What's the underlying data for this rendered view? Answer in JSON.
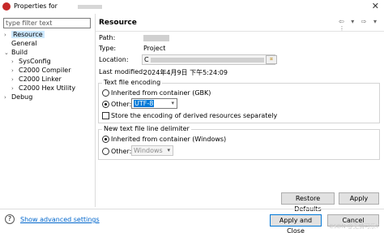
{
  "window": {
    "title": "Properties for",
    "close_symbol": "✕"
  },
  "filter": {
    "placeholder": "type filter text"
  },
  "tree": {
    "items": [
      {
        "label": "Resource",
        "arrow": "›",
        "selected": true
      },
      {
        "label": "General",
        "arrow": ""
      },
      {
        "label": "Build",
        "arrow": "⌄"
      },
      {
        "label": "SysConfig",
        "arrow": "›"
      },
      {
        "label": "C2000 Compiler",
        "arrow": "›"
      },
      {
        "label": "C2000 Linker",
        "arrow": "›"
      },
      {
        "label": "C2000 Hex Utility",
        "arrow": "›"
      },
      {
        "label": "Debug",
        "arrow": "›"
      }
    ]
  },
  "page": {
    "title": "Resource",
    "nav_icons": "⇦ ▾ ⇨ ▾ ⋮",
    "path_label": "Path:",
    "type_label": "Type:",
    "type_value": "Project",
    "location_label": "Location:",
    "location_value_prefix": "C",
    "last_modified_label": "Last modified:",
    "last_modified_value": "2024年4月9日 下午5:24:09"
  },
  "encoding": {
    "group_label": "Text file encoding",
    "inherited_label": "Inherited from container (GBK)",
    "other_label": "Other:",
    "other_value": "UTF-8",
    "store_label": "Store the encoding of derived resources separately"
  },
  "delimiter": {
    "group_label": "New text file line delimiter",
    "inherited_label": "Inherited from container (Windows)",
    "other_label": "Other:",
    "other_value": "Windows"
  },
  "buttons": {
    "restore_defaults": "Restore Defaults",
    "apply": "Apply",
    "apply_and_close": "Apply and Close",
    "cancel": "Cancel"
  },
  "footer": {
    "help_symbol": "?",
    "show_advanced": "Show advanced settings",
    "watermark": "CSDN @无情可乐Y"
  },
  "colors": {
    "selection": "#cce8ff",
    "accent": "#0078d7",
    "link": "#0066cc"
  }
}
